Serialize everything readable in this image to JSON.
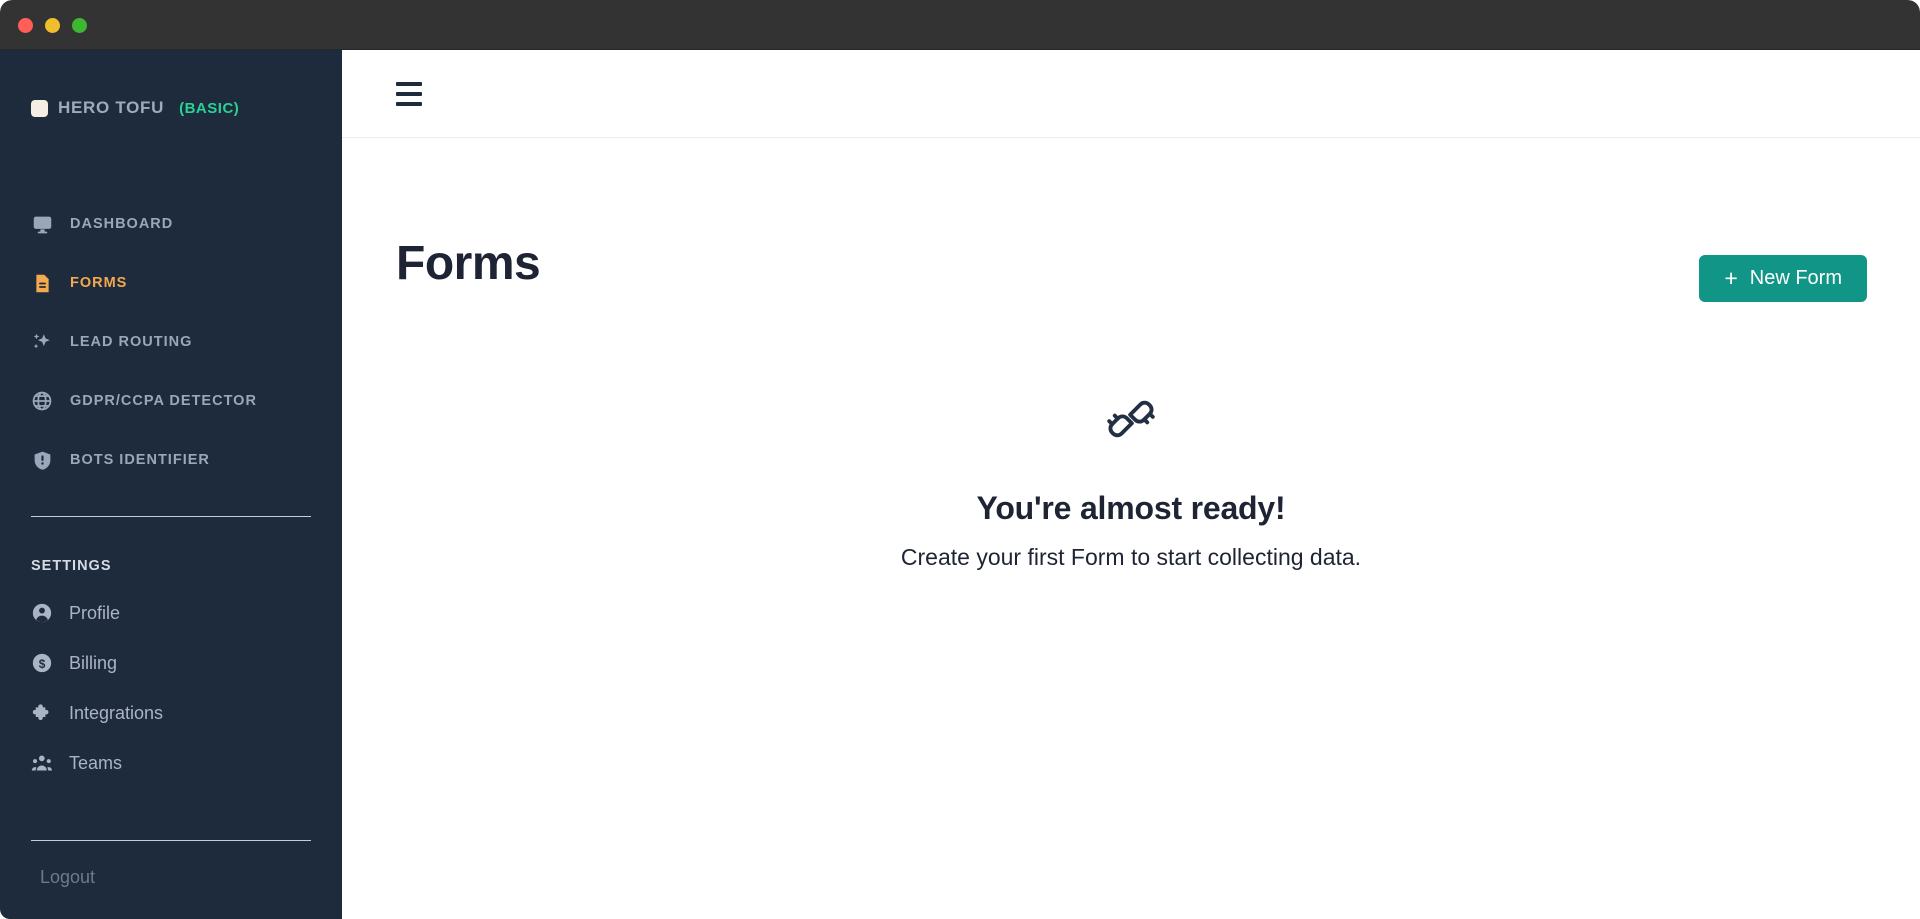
{
  "window": {
    "traffic_lights": [
      {
        "name": "close",
        "color": "#ff5f57"
      },
      {
        "name": "minimize",
        "color": "#f0bd2c"
      },
      {
        "name": "zoom",
        "color": "#3db631"
      }
    ],
    "titlebar_color": "#333333"
  },
  "sidebar": {
    "background": "#1e2b3c",
    "brand": {
      "mark_icon": "tofu-square-icon",
      "mark_color": "#f4efe2",
      "name": "HERO TOFU",
      "plan": "(BASIC)",
      "plan_color": "#2ad195"
    },
    "nav": [
      {
        "label": "DASHBOARD",
        "icon": "monitor-icon",
        "active": false
      },
      {
        "label": "FORMS",
        "icon": "document-icon",
        "active": true
      },
      {
        "label": "LEAD ROUTING",
        "icon": "sparkles-icon",
        "active": false
      },
      {
        "label": "GDPR/CCPA DETECTOR",
        "icon": "globe-icon",
        "active": false
      },
      {
        "label": "BOTS IDENTIFIER",
        "icon": "shield-icon",
        "active": false
      }
    ],
    "active_color": "#f5a94e",
    "settings_heading": "SETTINGS",
    "settings": [
      {
        "label": "Profile",
        "icon": "user-circle-icon"
      },
      {
        "label": "Billing",
        "icon": "dollar-circle-icon"
      },
      {
        "label": "Integrations",
        "icon": "puzzle-piece-icon"
      },
      {
        "label": "Teams",
        "icon": "people-icon"
      }
    ],
    "logout_label": "Logout"
  },
  "topbar": {
    "menu_icon": "hamburger-icon"
  },
  "main": {
    "page_title": "Forms",
    "new_form_button": {
      "plus": "+",
      "label": "New Form",
      "color": "#119587"
    },
    "empty_state": {
      "icon": "unplugged-plug-icon",
      "title": "You're almost ready!",
      "subtitle": "Create your first Form to start collecting data."
    }
  }
}
